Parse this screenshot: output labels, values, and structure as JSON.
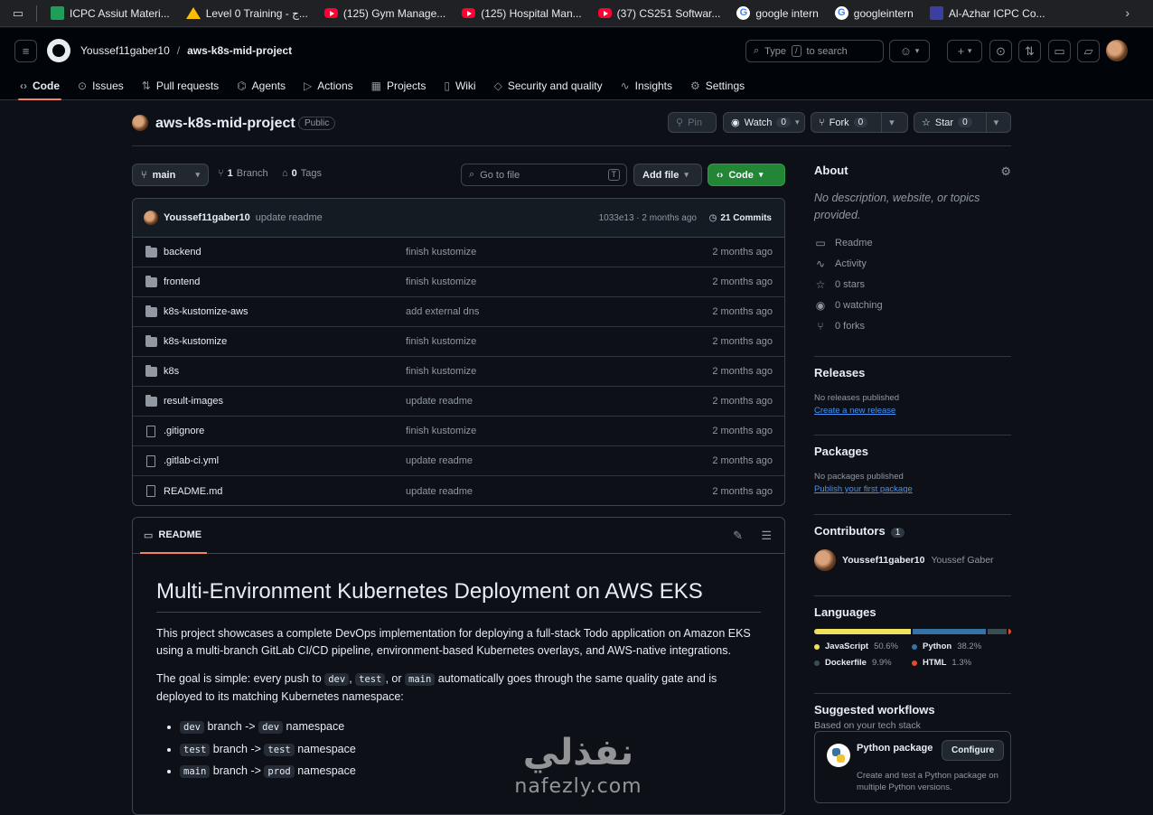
{
  "bookmarks": [
    {
      "icon": "sheets-icon",
      "label": "ICPC Assiut Materi..."
    },
    {
      "icon": "drive-icon",
      "label": "Level 0 Training - ج..."
    },
    {
      "icon": "youtube-icon",
      "label": "(125) Gym Manage..."
    },
    {
      "icon": "youtube-icon",
      "label": "(125) Hospital Man..."
    },
    {
      "icon": "youtube-icon",
      "label": "(37) CS251 Softwar..."
    },
    {
      "icon": "google-icon",
      "label": "google intern"
    },
    {
      "icon": "google-icon",
      "label": "googleintern"
    },
    {
      "icon": "icpc-icon",
      "label": "Al-Azhar ICPC Co..."
    }
  ],
  "header": {
    "owner": "Youssef11gaber10",
    "repo": "aws-k8s-mid-project",
    "search_prefix": "Type",
    "search_key": "/",
    "search_suffix": "to search"
  },
  "tabs": [
    {
      "icon": "code-icon",
      "glyph": "‹›",
      "label": "Code"
    },
    {
      "icon": "issues-icon",
      "glyph": "⊙",
      "label": "Issues"
    },
    {
      "icon": "pull-request-icon",
      "glyph": "⇅",
      "label": "Pull requests"
    },
    {
      "icon": "agents-icon",
      "glyph": "⌬",
      "label": "Agents"
    },
    {
      "icon": "actions-icon",
      "glyph": "▷",
      "label": "Actions"
    },
    {
      "icon": "projects-icon",
      "glyph": "▦",
      "label": "Projects"
    },
    {
      "icon": "wiki-icon",
      "glyph": "▯",
      "label": "Wiki"
    },
    {
      "icon": "shield-icon",
      "glyph": "◇",
      "label": "Security and quality"
    },
    {
      "icon": "graph-icon",
      "glyph": "∿",
      "label": "Insights"
    },
    {
      "icon": "gear-icon",
      "glyph": "⚙",
      "label": "Settings"
    }
  ],
  "repo": {
    "name": "aws-k8s-mid-project",
    "visibility": "Public",
    "pin_label": "Pin",
    "watch_label": "Watch",
    "watch_count": "0",
    "fork_label": "Fork",
    "fork_count": "0",
    "star_label": "Star",
    "star_count": "0"
  },
  "toolbar": {
    "branch": "main",
    "branches_count": "1",
    "branches_label": "Branch",
    "tags_count": "0",
    "tags_label": "Tags",
    "goto_placeholder": "Go to file",
    "goto_key": "T",
    "add_file_label": "Add file",
    "code_label": "Code"
  },
  "latest_commit": {
    "author": "Youssef11gaber10",
    "message": "update readme",
    "sha_time": "1033e13 · 2 months ago",
    "commits_label": "21 Commits"
  },
  "files": [
    {
      "type": "dir",
      "name": "backend",
      "message": "finish kustomize",
      "time": "2 months ago"
    },
    {
      "type": "dir",
      "name": "frontend",
      "message": "finish kustomize",
      "time": "2 months ago"
    },
    {
      "type": "dir",
      "name": "k8s-kustomize-aws",
      "message": "add external dns",
      "time": "2 months ago"
    },
    {
      "type": "dir",
      "name": "k8s-kustomize",
      "message": "finish kustomize",
      "time": "2 months ago"
    },
    {
      "type": "dir",
      "name": "k8s",
      "message": "finish kustomize",
      "time": "2 months ago"
    },
    {
      "type": "dir",
      "name": "result-images",
      "message": "update readme",
      "time": "2 months ago"
    },
    {
      "type": "file",
      "name": ".gitignore",
      "message": "finish kustomize",
      "time": "2 months ago"
    },
    {
      "type": "file",
      "name": ".gitlab-ci.yml",
      "message": "update readme",
      "time": "2 months ago"
    },
    {
      "type": "file",
      "name": "README.md",
      "message": "update readme",
      "time": "2 months ago"
    }
  ],
  "readme": {
    "tab_label": "README",
    "title": "Multi-Environment Kubernetes Deployment on AWS EKS",
    "p1": "This project showcases a complete DevOps implementation for deploying a full-stack Todo application on Amazon EKS using a multi-branch GitLab CI/CD pipeline, environment-based Kubernetes overlays, and AWS-native integrations.",
    "p2_a": "The goal is simple: every push to",
    "p2_code1": "dev",
    "p2_sep1": ",",
    "p2_code2": "test",
    "p2_sep2": ", or",
    "p2_code3": "main",
    "p2_b": "automatically goes through the same quality gate and is deployed to its matching Kubernetes namespace:",
    "bullets": [
      {
        "branch": "dev",
        "arrow": "branch ->",
        "ns": "dev",
        "suffix": "namespace"
      },
      {
        "branch": "test",
        "arrow": "branch ->",
        "ns": "test",
        "suffix": "namespace"
      },
      {
        "branch": "main",
        "arrow": "branch ->",
        "ns": "prod",
        "suffix": "namespace"
      }
    ]
  },
  "about": {
    "title": "About",
    "description": "No description, website, or topics provided.",
    "stats": [
      {
        "icon": "book-icon",
        "glyph": "▭",
        "label": "Readme"
      },
      {
        "icon": "activity-icon",
        "glyph": "∿",
        "label": "Activity"
      },
      {
        "icon": "star-icon",
        "glyph": "☆",
        "label": "0 stars"
      },
      {
        "icon": "eye-icon",
        "glyph": "◉",
        "label": "0 watching"
      },
      {
        "icon": "fork-icon",
        "glyph": "⑂",
        "label": "0 forks"
      }
    ]
  },
  "releases": {
    "title": "Releases",
    "text": "No releases published",
    "link": "Create a new release"
  },
  "packages": {
    "title": "Packages",
    "text": "No packages published",
    "link": "Publish your first package"
  },
  "contributors": {
    "title": "Contributors",
    "count": "1",
    "login": "Youssef11gaber10",
    "name": "Youssef Gaber"
  },
  "languages": {
    "title": "Languages",
    "items": [
      {
        "name": "JavaScript",
        "percent": 50.6,
        "percent_label": "50.6%",
        "color": "#f1e05a"
      },
      {
        "name": "Python",
        "percent": 38.2,
        "percent_label": "38.2%",
        "color": "#3572A5"
      },
      {
        "name": "Dockerfile",
        "percent": 9.9,
        "percent_label": "9.9%",
        "color": "#384d54"
      },
      {
        "name": "HTML",
        "percent": 1.3,
        "percent_label": "1.3%",
        "color": "#e34c26"
      }
    ]
  },
  "workflows": {
    "title": "Suggested workflows",
    "subtitle": "Based on your tech stack",
    "name": "Python package",
    "button": "Configure",
    "desc": "Create and test a Python package on multiple Python versions."
  },
  "watermark": {
    "arabic": "نفذلي",
    "latin": "nafezly.com"
  }
}
